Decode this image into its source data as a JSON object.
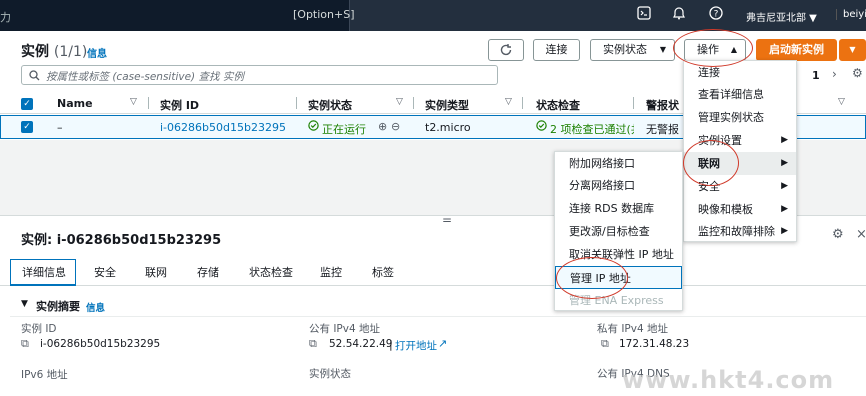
{
  "topbar": {
    "search_placeholder": "力",
    "search_shortcut": "[Option+S]",
    "region": "弗吉尼亚北部 ▼",
    "user": "beiyijia"
  },
  "header": {
    "title": "实例",
    "count": "(1/1)",
    "info": "信息",
    "refresh_icon": "refresh-icon",
    "connect": "连接",
    "instance_state": "实例状态",
    "actions": "操作",
    "launch": "启动新实例"
  },
  "filter": {
    "placeholder": "按属性或标签 (case-sensitive) 查找 实例",
    "page": "1"
  },
  "table": {
    "columns": [
      "Name",
      "实例 ID",
      "实例状态",
      "实例类型",
      "状态检查",
      "警报状"
    ],
    "row": {
      "name": "–",
      "id": "i-06286b50d15b23295",
      "state": "正在运行",
      "type": "t2.micro",
      "check": "2 项检查已通过(共",
      "alarm": "无警报"
    }
  },
  "actions_menu": {
    "items": [
      "连接",
      "查看详细信息",
      "管理实例状态",
      "实例设置",
      "联网",
      "安全",
      "映像和模板",
      "监控和故障排除"
    ]
  },
  "network_menu": {
    "items": [
      "附加网络接口",
      "分离网络接口",
      "连接 RDS 数据库",
      "更改源/目标检查",
      "取消关联弹性 IP 地址",
      "管理 IP 地址",
      "管理 ENA Express"
    ]
  },
  "detail": {
    "title": "实例: i-06286b50d15b23295",
    "tabs": [
      "详细信息",
      "安全",
      "联网",
      "存储",
      "状态检查",
      "监控",
      "标签"
    ],
    "summary": "实例摘要",
    "info": "信息",
    "fields": {
      "instance_id_label": "实例 ID",
      "instance_id": "i-06286b50d15b23295",
      "public_ipv4_label": "公有 IPv4 地址",
      "public_ipv4": "52.54.22.49",
      "open_address": "打开地址",
      "private_ipv4_label": "私有 IPv4 地址",
      "private_ipv4": "172.31.48.23",
      "ipv6_label": "IPv6 地址",
      "state_label": "实例状态",
      "public_dns_label": "公有 IPv4 DNS"
    }
  },
  "watermark": "www.hkt4.com",
  "colors": {
    "topbar": "#232f3e",
    "accent": "#0073bb",
    "orange": "#ec7211",
    "green": "#1d8102",
    "annotation": "#d03a2a"
  }
}
